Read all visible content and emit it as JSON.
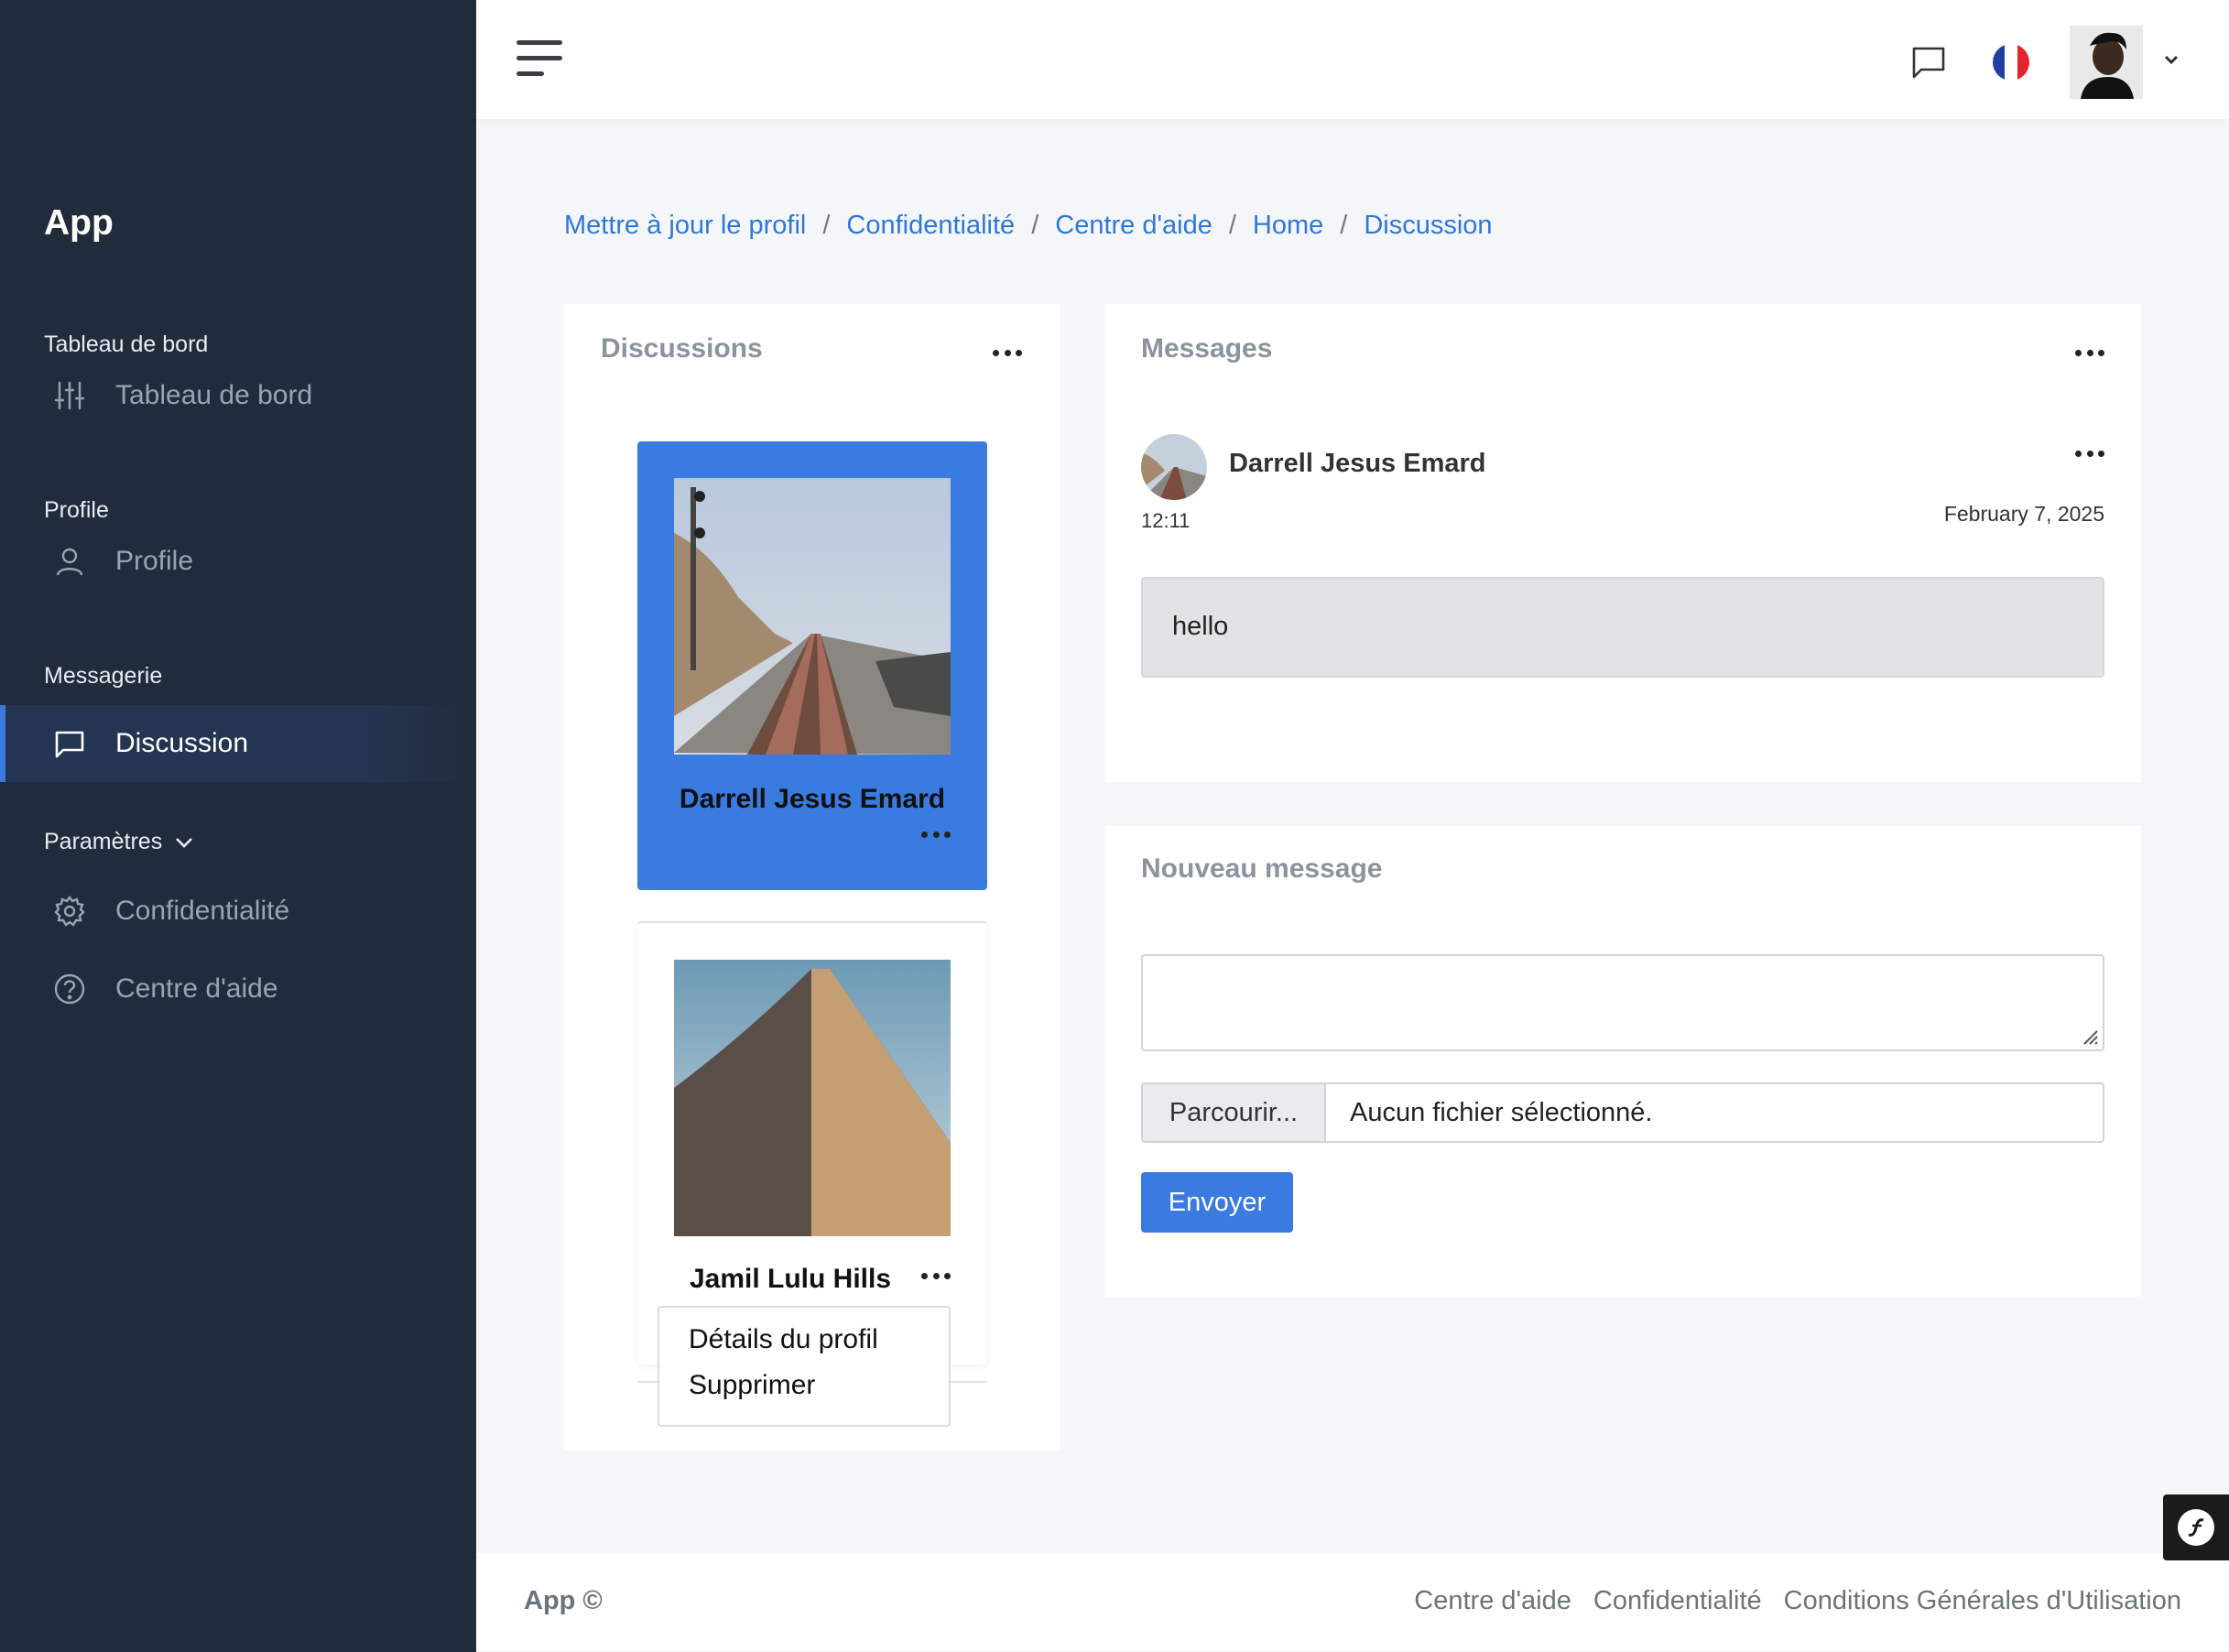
{
  "sidebar": {
    "brand": "App",
    "sections": [
      {
        "title": "Tableau de bord",
        "items": [
          {
            "label": "Tableau de bord",
            "icon": "sliders-icon"
          }
        ]
      },
      {
        "title": "Profile",
        "items": [
          {
            "label": "Profile",
            "icon": "user-icon"
          }
        ]
      },
      {
        "title": "Messagerie",
        "items": [
          {
            "label": "Discussion",
            "icon": "chat-icon",
            "active": true
          }
        ]
      },
      {
        "title": "Paramètres",
        "items": [
          {
            "label": "Confidentialité",
            "icon": "gear-icon"
          },
          {
            "label": "Centre d'aide",
            "icon": "help-circle-icon"
          }
        ]
      }
    ]
  },
  "topbar": {
    "menu_icon": "hamburger-icon",
    "chat_icon": "chat-icon",
    "language_flag": "fr-flag-icon",
    "avatar_icon": "user-avatar",
    "dropdown_icon": "chevron-down-icon"
  },
  "breadcrumb": [
    "Mettre à jour le profil",
    "Confidentialité",
    "Centre d'aide",
    "Home",
    "Discussion"
  ],
  "discussions": {
    "title": "Discussions",
    "contacts": [
      {
        "name": "Darrell Jesus Emard",
        "selected": true
      },
      {
        "name": "Jamil Lulu Hills",
        "selected": false
      }
    ],
    "dropdown": [
      "Détails du profil",
      "Supprimer"
    ]
  },
  "messages": {
    "title": "Messages",
    "author": "Darrell Jesus Emard",
    "time": "12:11",
    "date": "February 7, 2025",
    "text": "hello"
  },
  "new_message": {
    "title": "Nouveau message",
    "browse": "Parcourir...",
    "no_file": "Aucun fichier sélectionné.",
    "send": "Envoyer"
  },
  "footer": {
    "brand": "App ©",
    "links": [
      "Centre d'aide",
      "Confidentialité",
      "Conditions Générales d'Utilisation"
    ]
  },
  "colors": {
    "sidebar": "#222b3b",
    "accent": "#3a7be0",
    "link": "#2f77d8"
  }
}
